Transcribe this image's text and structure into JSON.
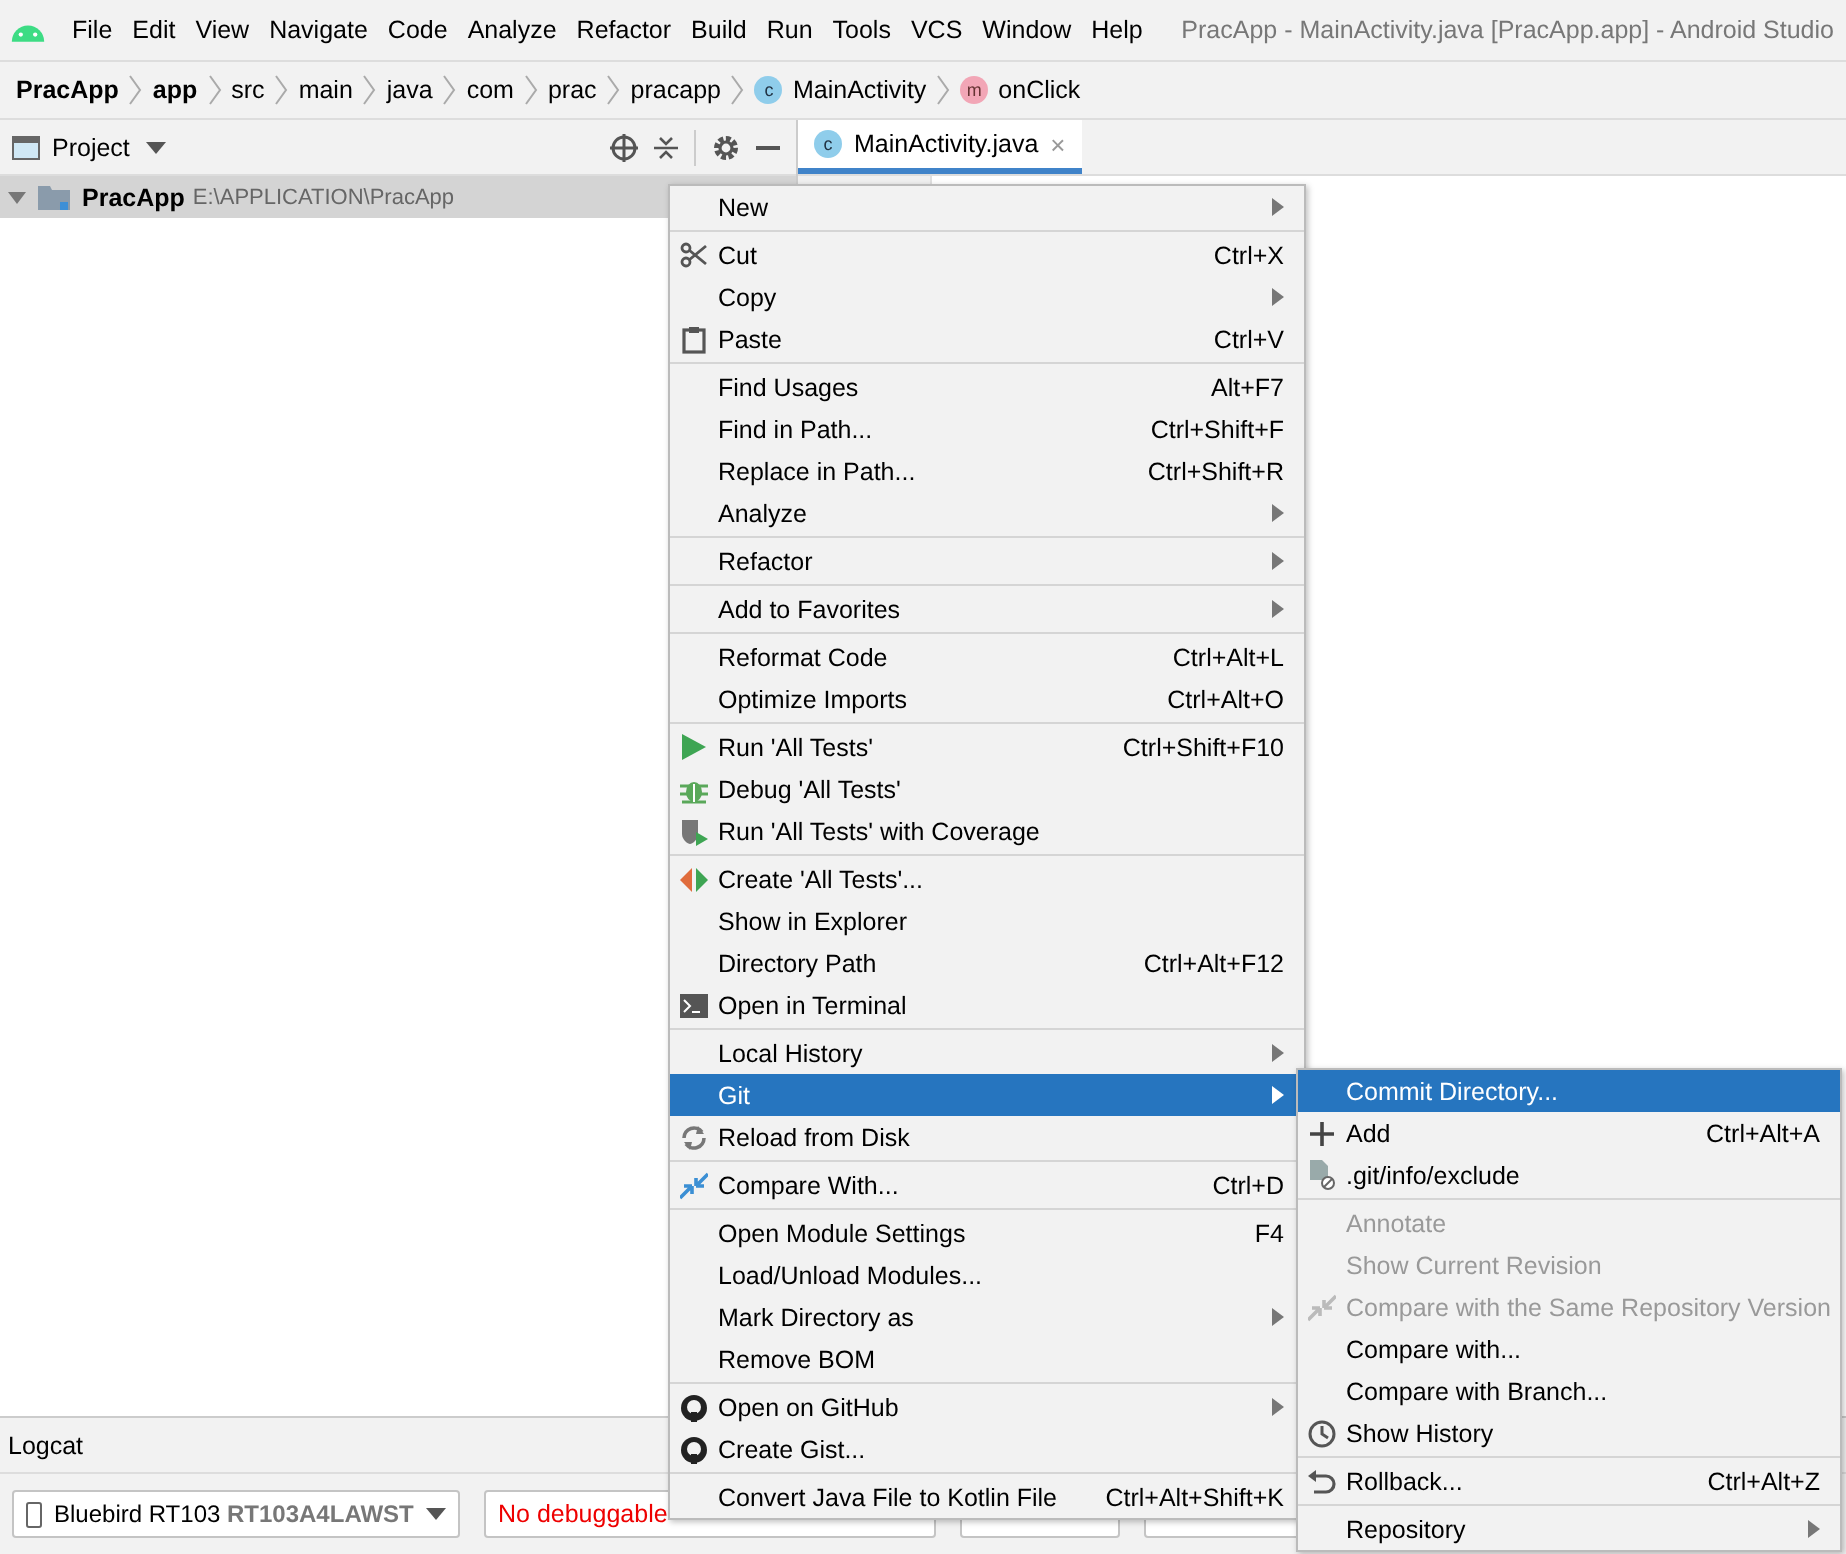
{
  "menu_bar": {
    "items": [
      "File",
      "Edit",
      "View",
      "Navigate",
      "Code",
      "Analyze",
      "Refactor",
      "Build",
      "Run",
      "Tools",
      "VCS",
      "Window",
      "Help"
    ],
    "title": "PracApp - MainActivity.java [PracApp.app] - Android Studio"
  },
  "breadcrumb": [
    {
      "label": "PracApp",
      "kind": "module"
    },
    {
      "label": "app",
      "kind": "module"
    },
    {
      "label": "src",
      "kind": "folder"
    },
    {
      "label": "main",
      "kind": "folder"
    },
    {
      "label": "java",
      "kind": "folder"
    },
    {
      "label": "com",
      "kind": "folder"
    },
    {
      "label": "prac",
      "kind": "folder"
    },
    {
      "label": "pracapp",
      "kind": "folder"
    },
    {
      "label": "MainActivity",
      "kind": "class",
      "glyph": "c"
    },
    {
      "label": "onClick",
      "kind": "method",
      "glyph": "m"
    }
  ],
  "project_panel": {
    "title": "Project",
    "tree": [
      {
        "label": "PracApp",
        "path": "E:\\APPLICATION\\PracApp",
        "selected": true
      }
    ]
  },
  "editor": {
    "tab": {
      "label": "MainActivity.java",
      "glyph": "c",
      "close": "×"
    }
  },
  "context_menu": [
    {
      "kind": "item",
      "label": "New",
      "submenu": true
    },
    {
      "kind": "separator"
    },
    {
      "kind": "item",
      "label": "Cut",
      "shortcut": "Ctrl+X"
    },
    {
      "kind": "item",
      "label": "Copy",
      "submenu": true
    },
    {
      "kind": "item",
      "label": "Paste",
      "shortcut": "Ctrl+V"
    },
    {
      "kind": "separator"
    },
    {
      "kind": "item",
      "label": "Find Usages",
      "shortcut": "Alt+F7"
    },
    {
      "kind": "item",
      "label": "Find in Path...",
      "shortcut": "Ctrl+Shift+F"
    },
    {
      "kind": "item",
      "label": "Replace in Path...",
      "shortcut": "Ctrl+Shift+R"
    },
    {
      "kind": "item",
      "label": "Analyze",
      "submenu": true
    },
    {
      "kind": "separator"
    },
    {
      "kind": "item",
      "label": "Refactor",
      "submenu": true
    },
    {
      "kind": "separator"
    },
    {
      "kind": "item",
      "label": "Add to Favorites",
      "submenu": true
    },
    {
      "kind": "separator"
    },
    {
      "kind": "item",
      "label": "Reformat Code",
      "shortcut": "Ctrl+Alt+L"
    },
    {
      "kind": "item",
      "label": "Optimize Imports",
      "shortcut": "Ctrl+Alt+O"
    },
    {
      "kind": "separator"
    },
    {
      "kind": "item",
      "label": "Run 'All Tests'",
      "shortcut": "Ctrl+Shift+F10"
    },
    {
      "kind": "item",
      "label": "Debug 'All Tests'"
    },
    {
      "kind": "item",
      "label": "Run 'All Tests' with Coverage"
    },
    {
      "kind": "separator"
    },
    {
      "kind": "item",
      "label": "Create 'All Tests'..."
    },
    {
      "kind": "item",
      "label": "Show in Explorer"
    },
    {
      "kind": "item",
      "label": "Directory Path",
      "shortcut": "Ctrl+Alt+F12"
    },
    {
      "kind": "item",
      "label": "Open in Terminal"
    },
    {
      "kind": "separator"
    },
    {
      "kind": "item",
      "label": "Local History",
      "submenu": true
    },
    {
      "kind": "item",
      "label": "Git",
      "submenu": true,
      "selected": true
    },
    {
      "kind": "item",
      "label": "Reload from Disk"
    },
    {
      "kind": "separator"
    },
    {
      "kind": "item",
      "label": "Compare With...",
      "shortcut": "Ctrl+D"
    },
    {
      "kind": "separator"
    },
    {
      "kind": "item",
      "label": "Open Module Settings",
      "shortcut": "F4"
    },
    {
      "kind": "item",
      "label": "Load/Unload Modules..."
    },
    {
      "kind": "item",
      "label": "Mark Directory as",
      "submenu": true
    },
    {
      "kind": "item",
      "label": "Remove BOM"
    },
    {
      "kind": "separator"
    },
    {
      "kind": "item",
      "label": "Open on GitHub",
      "submenu": true
    },
    {
      "kind": "item",
      "label": "Create Gist..."
    },
    {
      "kind": "separator"
    },
    {
      "kind": "item",
      "label": "Convert Java File to Kotlin File",
      "shortcut": "Ctrl+Alt+Shift+K"
    }
  ],
  "git_submenu": [
    {
      "kind": "item",
      "label": "Commit Directory...",
      "selected": true
    },
    {
      "kind": "item",
      "label": "Add",
      "shortcut": "Ctrl+Alt+A"
    },
    {
      "kind": "item",
      "label": ".git/info/exclude"
    },
    {
      "kind": "separator"
    },
    {
      "kind": "item",
      "label": "Annotate",
      "disabled": true
    },
    {
      "kind": "item",
      "label": "Show Current Revision",
      "disabled": true
    },
    {
      "kind": "item",
      "label": "Compare with the Same Repository Version",
      "disabled": true
    },
    {
      "kind": "item",
      "label": "Compare with..."
    },
    {
      "kind": "item",
      "label": "Compare with Branch..."
    },
    {
      "kind": "item",
      "label": "Show History"
    },
    {
      "kind": "separator"
    },
    {
      "kind": "item",
      "label": "Rollback...",
      "shortcut": "Ctrl+Alt+Z"
    },
    {
      "kind": "separator"
    },
    {
      "kind": "item",
      "label": "Repository",
      "submenu": true
    }
  ],
  "logcat": {
    "title": "Logcat",
    "device": "Bluebird RT103",
    "serial": "RT103A4LAWST",
    "process": "No debuggable"
  }
}
